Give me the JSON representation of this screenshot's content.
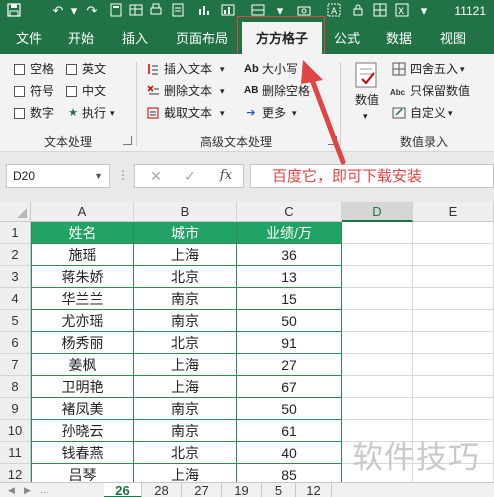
{
  "titlebar": {
    "title": "11121",
    "icons": [
      "save-icon",
      "undo-icon",
      "redo-icon",
      "calculator-icon",
      "chart-icon",
      "camera-icon",
      "text-box-icon",
      "grid-icon",
      "print-icon"
    ]
  },
  "tabs": [
    {
      "label": "文件"
    },
    {
      "label": "开始"
    },
    {
      "label": "插入"
    },
    {
      "label": "页面布局"
    },
    {
      "label": "方方格子",
      "active": true
    },
    {
      "label": "公式"
    },
    {
      "label": "数据"
    },
    {
      "label": "视图"
    }
  ],
  "ribbon": {
    "text_group": {
      "label": "文本处理",
      "items": [
        "空格",
        "英文",
        "符号",
        "中文",
        "数字",
        "执行"
      ]
    },
    "adv_group": {
      "label": "高级文本处理",
      "items": [
        "插入文本",
        "删除文本",
        "截取文本",
        "大小写",
        "删除空格",
        "更多"
      ],
      "icons": [
        "Ab",
        "AB"
      ]
    },
    "num_group": {
      "label": "数值录入",
      "big_button": "数值",
      "items": [
        "四舍五入",
        "只保留数值",
        "自定义"
      ]
    }
  },
  "formula_bar": {
    "name_box": "D20",
    "cancel": "✕",
    "enter": "✓",
    "fx": "fx",
    "annotation": "百度它，即可下载安装"
  },
  "sheet": {
    "columns": [
      "A",
      "B",
      "C",
      "D",
      "E"
    ],
    "header_row": [
      "姓名",
      "城市",
      "业绩/万"
    ],
    "rows": [
      [
        "施瑶",
        "上海",
        "36"
      ],
      [
        "蒋朱娇",
        "北京",
        "13"
      ],
      [
        "华兰兰",
        "南京",
        "15"
      ],
      [
        "尤亦瑶",
        "南京",
        "50"
      ],
      [
        "杨秀丽",
        "北京",
        "91"
      ],
      [
        "姜枫",
        "上海",
        "27"
      ],
      [
        "卫明艳",
        "上海",
        "67"
      ],
      [
        "褚凤美",
        "南京",
        "50"
      ],
      [
        "孙晓云",
        "南京",
        "61"
      ],
      [
        "钱春燕",
        "北京",
        "40"
      ],
      [
        "吕琴",
        "上海",
        "85"
      ]
    ],
    "row_numbers": [
      "1",
      "2",
      "3",
      "4",
      "5",
      "6",
      "7",
      "8",
      "9",
      "10",
      "11",
      "12"
    ]
  },
  "watermark": "软件技巧",
  "sheet_tabs": [
    {
      "label": "26",
      "active": true
    },
    {
      "label": "28"
    },
    {
      "label": "27"
    },
    {
      "label": "19"
    },
    {
      "label": "5"
    },
    {
      "label": "12"
    }
  ],
  "colors": {
    "brand": "#217346",
    "table_header": "#21a366",
    "annotation": "#e04545"
  }
}
